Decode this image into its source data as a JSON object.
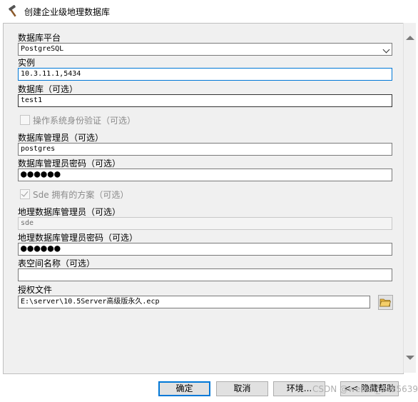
{
  "window": {
    "title": "创建企业级地理数据库",
    "icon": "hammer-icon"
  },
  "form": {
    "platform": {
      "label": "数据库平台",
      "value": "PostgreSQL"
    },
    "instance": {
      "label": "实例",
      "value": "10.3.11.1,5434"
    },
    "database": {
      "label": "数据库（可选）",
      "value": "test1"
    },
    "os_auth": {
      "label": "操作系统身份验证（可选）",
      "checked": false
    },
    "db_admin": {
      "label": "数据库管理员（可选）",
      "value": "postgres"
    },
    "db_admin_password": {
      "label": "数据库管理员密码（可选）",
      "value": "●●●●●●"
    },
    "sde_schema": {
      "label": "Sde 拥有的方案（可选）",
      "checked": true
    },
    "gdb_admin": {
      "label": "地理数据库管理员（可选）",
      "value": "sde"
    },
    "gdb_admin_password": {
      "label": "地理数据库管理员密码（可选）",
      "value": "●●●●●●"
    },
    "tablespace": {
      "label": "表空间名称（可选）",
      "value": ""
    },
    "auth_file": {
      "label": "授权文件",
      "value": "E:\\server\\10.5Server高级版永久.ecp"
    }
  },
  "buttons": {
    "ok": "确定",
    "cancel": "取消",
    "environments": "环境...",
    "hide_help": "<< 隐藏帮助"
  },
  "watermark": "CSDN @weixin_44856391",
  "colors": {
    "focus": "#0078d7",
    "folder": "#e9b43c"
  }
}
